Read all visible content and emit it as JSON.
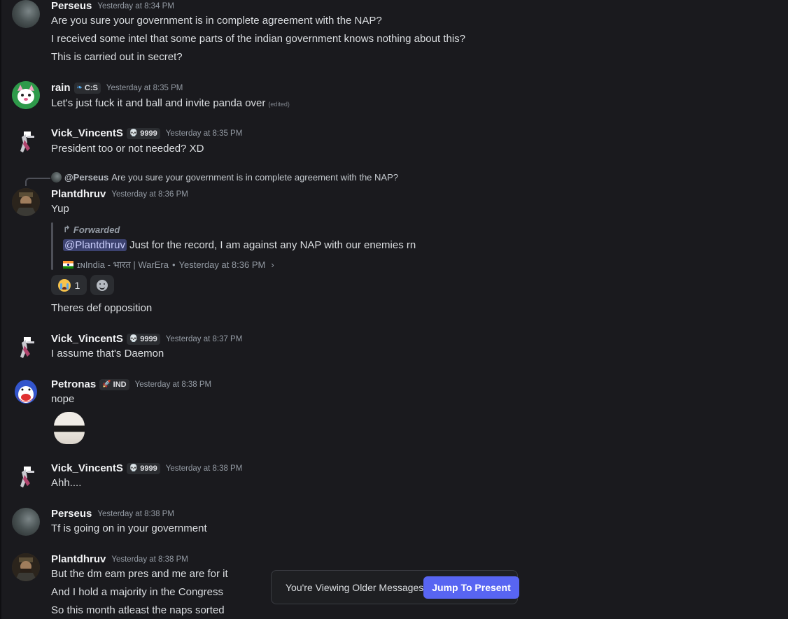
{
  "messages": {
    "m1": {
      "username": "Perseus",
      "timestamp": "Yesterday at 8:34 PM",
      "lines": [
        "Are you sure your government is in complete agreement with the NAP?",
        "I received some intel that some parts of the indian government knows nothing about this?",
        "This is carried out in secret?"
      ]
    },
    "m2": {
      "username": "rain",
      "tag": "C:S",
      "timestamp": "Yesterday at 8:35 PM",
      "text": "Let's just fuck it and ball and invite panda over",
      "edited": "(edited)"
    },
    "m3": {
      "username": "Vick_VincentS",
      "tag": "9999",
      "timestamp": "Yesterday at 8:35 PM",
      "text": "President too or not needed? XD"
    },
    "m4": {
      "reply_name": "@Perseus",
      "reply_text": "Are you sure your government is in complete agreement with the NAP?",
      "username": "Plantdhruv",
      "timestamp": "Yesterday at 8:36 PM",
      "text": "Yup",
      "forwarded_label": "Forwarded",
      "forwarded_mention": "@Plantdhruv",
      "forwarded_text": " Just for the record, I am against any NAP with our enemies rn",
      "forwarded_source": "ɪɴIndia - भारत | WarEra",
      "forwarded_time": "Yesterday at 8:36 PM",
      "reaction_count": "1",
      "followup": "Theres def opposition"
    },
    "m5": {
      "username": "Vick_VincentS",
      "tag": "9999",
      "timestamp": "Yesterday at 8:37 PM",
      "text": "I assume that's Daemon"
    },
    "m6": {
      "username": "Petronas",
      "tag": "IND",
      "timestamp": "Yesterday at 8:38 PM",
      "text": "nope"
    },
    "m7": {
      "username": "Vick_VincentS",
      "tag": "9999",
      "timestamp": "Yesterday at 8:38 PM",
      "text": "Ahh...."
    },
    "m8": {
      "username": "Perseus",
      "timestamp": "Yesterday at 8:38 PM",
      "text": "Tf is going on in your government"
    },
    "m9": {
      "username": "Plantdhruv",
      "timestamp": "Yesterday at 8:38 PM",
      "lines": [
        "But the dm eam pres and me are for it",
        "And I hold a majority in the Congress",
        "So this month atleast the naps sorted"
      ]
    }
  },
  "jump_bar": {
    "text": "You're Viewing Older Messages",
    "button": "Jump To Present"
  },
  "colors": {
    "background": "#1a1a1e",
    "accent": "#5865f2",
    "mention_bg": "#3c4270"
  }
}
